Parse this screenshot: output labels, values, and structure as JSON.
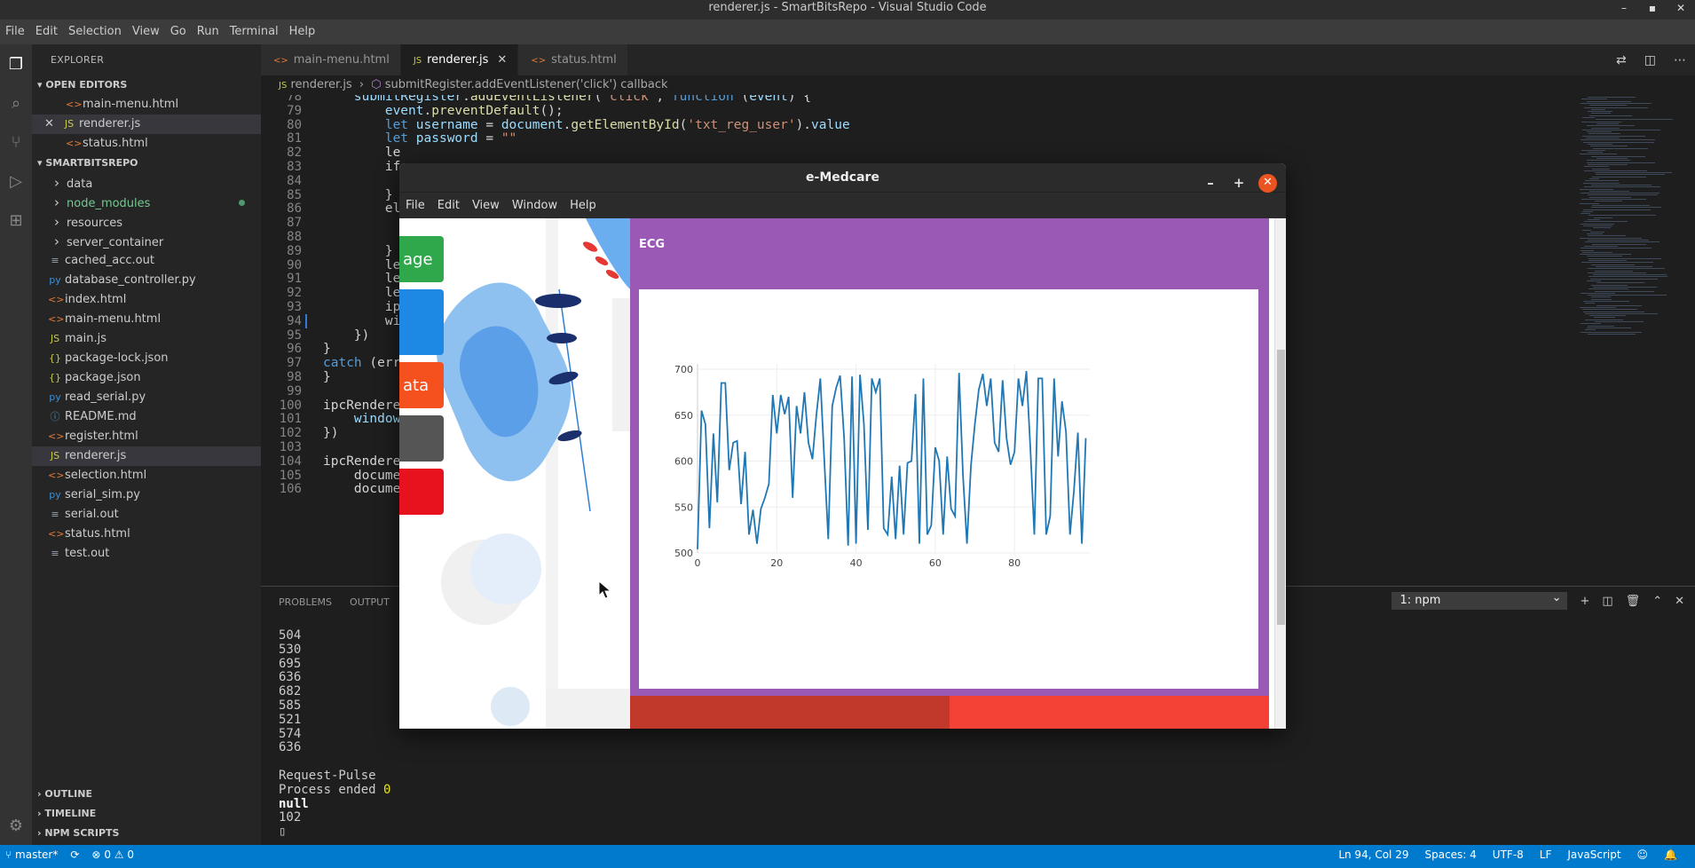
{
  "window_title": "renderer.js - SmartBitsRepo - Visual Studio Code",
  "menu": [
    "File",
    "Edit",
    "Selection",
    "View",
    "Go",
    "Run",
    "Terminal",
    "Help"
  ],
  "explorer": {
    "header": "EXPLORER",
    "open_editors_title": "OPEN EDITORS",
    "open_editors": [
      {
        "name": "main-menu.html",
        "icon": "html-icon"
      },
      {
        "name": "renderer.js",
        "icon": "js-icon"
      },
      {
        "name": "status.html",
        "icon": "html-icon"
      }
    ],
    "repo_title": "SMARTBITSREPO",
    "files": [
      {
        "name": "data",
        "type": "folder"
      },
      {
        "name": "node_modules",
        "type": "folder",
        "modified": true
      },
      {
        "name": "resources",
        "type": "folder"
      },
      {
        "name": "server_container",
        "type": "folder"
      },
      {
        "name": "cached_acc.out",
        "type": "file",
        "icon": "≡"
      },
      {
        "name": "database_controller.py",
        "type": "file",
        "icon": "py"
      },
      {
        "name": "index.html",
        "type": "file",
        "icon": "<>"
      },
      {
        "name": "main-menu.html",
        "type": "file",
        "icon": "<>"
      },
      {
        "name": "main.js",
        "type": "file",
        "icon": "JS"
      },
      {
        "name": "package-lock.json",
        "type": "file",
        "icon": "{}"
      },
      {
        "name": "package.json",
        "type": "file",
        "icon": "{}"
      },
      {
        "name": "read_serial.py",
        "type": "file",
        "icon": "py"
      },
      {
        "name": "README.md",
        "type": "file",
        "icon": "ⓘ"
      },
      {
        "name": "register.html",
        "type": "file",
        "icon": "<>"
      },
      {
        "name": "renderer.js",
        "type": "file",
        "icon": "JS",
        "selected": true
      },
      {
        "name": "selection.html",
        "type": "file",
        "icon": "<>"
      },
      {
        "name": "serial_sim.py",
        "type": "file",
        "icon": "py"
      },
      {
        "name": "serial.out",
        "type": "file",
        "icon": "≡"
      },
      {
        "name": "status.html",
        "type": "file",
        "icon": "<>"
      },
      {
        "name": "test.out",
        "type": "file",
        "icon": "≡"
      }
    ],
    "outline": "OUTLINE",
    "timeline": "TIMELINE",
    "npm_scripts": "NPM SCRIPTS"
  },
  "tabs": [
    {
      "label": "main-menu.html",
      "icon": "<>"
    },
    {
      "label": "renderer.js",
      "icon": "JS",
      "active": true
    },
    {
      "label": "status.html",
      "icon": "<>"
    }
  ],
  "breadcrumb": [
    "renderer.js",
    "submitRegister.addEventListener('click') callback"
  ],
  "code_lines": [
    {
      "n": "78",
      "text": "    submitRegister.addEventListener('click', function (event) {"
    },
    {
      "n": "79",
      "text": "        event.preventDefault();"
    },
    {
      "n": "80",
      "text": "        let username = document.getElementById('txt_reg_user').value"
    },
    {
      "n": "81",
      "text": "        let password = \"\""
    },
    {
      "n": "82",
      "text": "        le"
    },
    {
      "n": "83",
      "text": "        if"
    },
    {
      "n": "84",
      "text": ""
    },
    {
      "n": "85",
      "text": "        }"
    },
    {
      "n": "86",
      "text": "        el"
    },
    {
      "n": "87",
      "text": ""
    },
    {
      "n": "88",
      "text": ""
    },
    {
      "n": "89",
      "text": "        }"
    },
    {
      "n": "90",
      "text": "        le"
    },
    {
      "n": "91",
      "text": "        le"
    },
    {
      "n": "92",
      "text": "        le"
    },
    {
      "n": "93",
      "text": "        ip"
    },
    {
      "n": "94",
      "text": "        wi"
    },
    {
      "n": "95",
      "text": "    })"
    },
    {
      "n": "96",
      "text": "}"
    },
    {
      "n": "97",
      "text": "catch (err"
    },
    {
      "n": "98",
      "text": "}"
    },
    {
      "n": "99",
      "text": ""
    },
    {
      "n": "100",
      "text": "ipcRendere"
    },
    {
      "n": "101",
      "text": "    window."
    },
    {
      "n": "102",
      "text": "})"
    },
    {
      "n": "103",
      "text": ""
    },
    {
      "n": "104",
      "text": "ipcRendere"
    },
    {
      "n": "105",
      "text": "    docume"
    },
    {
      "n": "106",
      "text": "    docume"
    }
  ],
  "panel": {
    "tabs": [
      "PROBLEMS",
      "OUTPUT"
    ],
    "terminal_select": "1: npm",
    "lines": [
      "504",
      "530",
      "695",
      "636",
      "682",
      "585",
      "521",
      "574",
      "636",
      "",
      "Request-Pulse",
      "Process ended 0",
      "null",
      "102"
    ]
  },
  "statusbar": {
    "branch": "master*",
    "errors": "0",
    "warnings": "0",
    "position": "Ln 94, Col 29",
    "spaces": "Spaces: 4",
    "encoding": "UTF-8",
    "eol": "LF",
    "language": "JavaScript"
  },
  "app": {
    "title": "e-Medcare",
    "menu": [
      "File",
      "Edit",
      "View",
      "Window",
      "Help"
    ],
    "side_buttons": [
      {
        "label": "age",
        "color": "#2ea84a"
      },
      {
        "label": "",
        "color": "#1e88e5"
      },
      {
        "label": "ata",
        "color": "#f4511e"
      },
      {
        "label": "",
        "color": "#555555"
      },
      {
        "label": "",
        "color": "#e8121f"
      }
    ],
    "ecg_title": "ECG"
  },
  "chart_data": {
    "type": "line",
    "title": "",
    "xlabel": "",
    "ylabel": "",
    "xlim": [
      0,
      99
    ],
    "ylim": [
      500,
      700
    ],
    "x_ticks": [
      0,
      20,
      40,
      60,
      80
    ],
    "y_ticks": [
      500,
      550,
      600,
      650,
      700
    ],
    "color": "#1f77b4",
    "grid": true,
    "values": [
      504,
      655,
      640,
      527,
      630,
      555,
      685,
      685,
      590,
      620,
      622,
      553,
      610,
      520,
      547,
      510,
      548,
      560,
      575,
      672,
      630,
      672,
      651,
      670,
      560,
      660,
      630,
      675,
      620,
      602,
      650,
      690,
      600,
      515,
      660,
      680,
      693,
      625,
      508,
      692,
      510,
      694,
      640,
      525,
      690,
      675,
      690,
      527,
      520,
      583,
      515,
      595,
      520,
      598,
      600,
      673,
      510,
      690,
      520,
      530,
      615,
      600,
      520,
      605,
      548,
      540,
      696,
      585,
      510,
      595,
      640,
      678,
      695,
      660,
      690,
      620,
      610,
      688,
      625,
      596,
      610,
      690,
      660,
      698,
      615,
      520,
      690,
      690,
      520,
      540,
      690,
      605,
      665,
      632,
      520,
      567,
      631,
      510,
      625
    ]
  }
}
